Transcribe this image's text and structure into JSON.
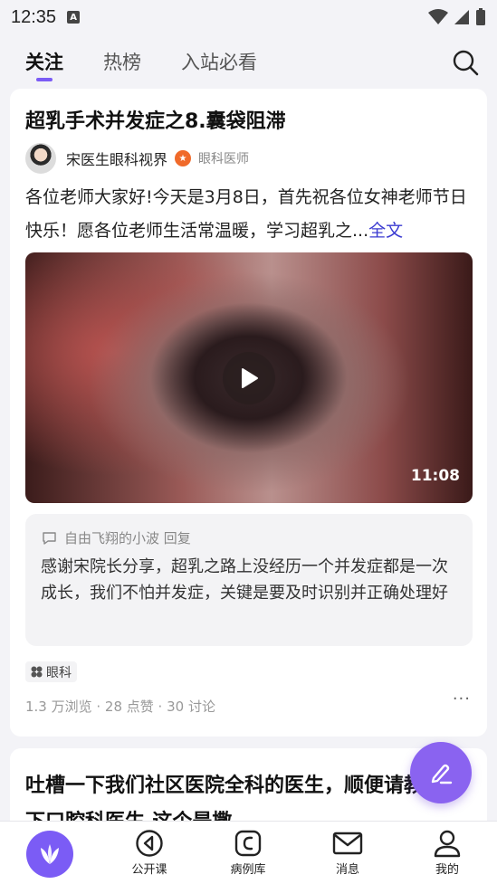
{
  "status": {
    "time": "12:35",
    "notif_icon_label": "A"
  },
  "tabs": [
    {
      "label": "关注"
    },
    {
      "label": "热榜"
    },
    {
      "label": "入站必看"
    }
  ],
  "post": {
    "title": "超乳手术并发症之8.囊袋阻滞",
    "author": "宋医生眼科视界",
    "role": "眼科医师",
    "body": "各位老师大家好!今天是3月8日，首先祝各位女神老师节日快乐！愿各位老师生活常温暖，学习超乳之...",
    "more": "全文",
    "video_duration": "11:08",
    "reply_head": "自由飞翔的小波 回复",
    "reply_text": "感谢宋院长分享，超乳之路上没经历一个并发症都是一次成长，我们不怕并发症，关键是要及时识别并正确处理好",
    "tag": "眼科",
    "stats": "1.3 万浏览 · 28 点赞 · 30 讨论",
    "more_dots": "···"
  },
  "post2": {
    "title": "吐槽一下我们社区医院全科的医生，顺便请教一下口腔科医生,这个是撒"
  },
  "bottom_nav": [
    {
      "label": "公开课"
    },
    {
      "label": "病例库"
    },
    {
      "label": "消息"
    },
    {
      "label": "我的"
    }
  ],
  "colors": {
    "accent": "#7b5cf5",
    "link": "#3b3bd1"
  }
}
